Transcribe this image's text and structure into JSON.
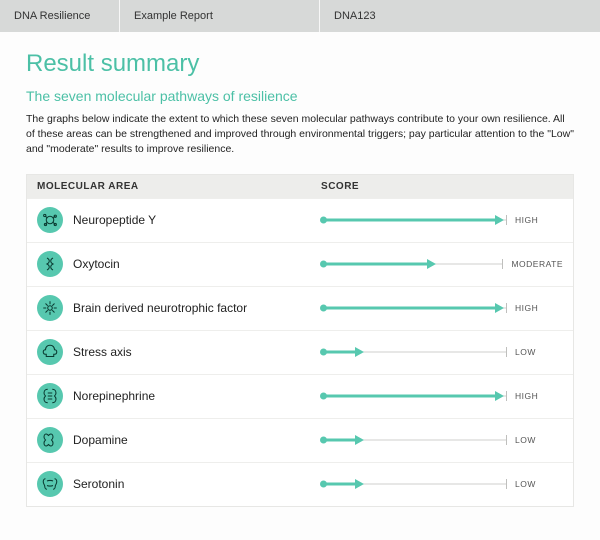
{
  "colors": {
    "accent": "#4cc0a6",
    "bar": "#57c8af",
    "track": "#cfcfcd",
    "header_bg": "#d7d9d8"
  },
  "topbar": {
    "product": "DNA Resilience",
    "report": "Example Report",
    "code": "DNA123"
  },
  "title": "Result summary",
  "subtitle": "The seven molecular pathways of resilience",
  "blurb": "The graphs below indicate the extent to which these seven molecular pathways contribute to your own resilience. All of these areas can be strengthened and improved through environmental triggers; pay particular attention to the \"Low\" and \"moderate\" results to improve resilience.",
  "table": {
    "headers": {
      "area": "MOLECULAR AREA",
      "score": "SCORE"
    },
    "rows": [
      {
        "icon": "neuropeptide-icon",
        "label": "Neuropeptide Y",
        "score_pct": 95,
        "score_text": "HIGH"
      },
      {
        "icon": "oxytocin-icon",
        "label": "Oxytocin",
        "score_pct": 60,
        "score_text": "MODERATE"
      },
      {
        "icon": "bdnf-icon",
        "label": "Brain derived neurotrophic factor",
        "score_pct": 95,
        "score_text": "HIGH"
      },
      {
        "icon": "stress-axis-icon",
        "label": "Stress axis",
        "score_pct": 20,
        "score_text": "LOW"
      },
      {
        "icon": "norepinephrine-icon",
        "label": "Norepinephrine",
        "score_pct": 95,
        "score_text": "HIGH"
      },
      {
        "icon": "dopamine-icon",
        "label": "Dopamine",
        "score_pct": 20,
        "score_text": "LOW"
      },
      {
        "icon": "serotonin-icon",
        "label": "Serotonin",
        "score_pct": 20,
        "score_text": "LOW"
      }
    ]
  },
  "chart_data": {
    "type": "bar",
    "title": "The seven molecular pathways of resilience — score",
    "xlabel": "Score",
    "ylabel": "Molecular area",
    "xlim": [
      0,
      100
    ],
    "categories": [
      "Neuropeptide Y",
      "Oxytocin",
      "Brain derived neurotrophic factor",
      "Stress axis",
      "Norepinephrine",
      "Dopamine",
      "Serotonin"
    ],
    "values": [
      95,
      60,
      95,
      20,
      95,
      20,
      20
    ],
    "value_labels": [
      "HIGH",
      "MODERATE",
      "HIGH",
      "LOW",
      "HIGH",
      "LOW",
      "LOW"
    ]
  }
}
